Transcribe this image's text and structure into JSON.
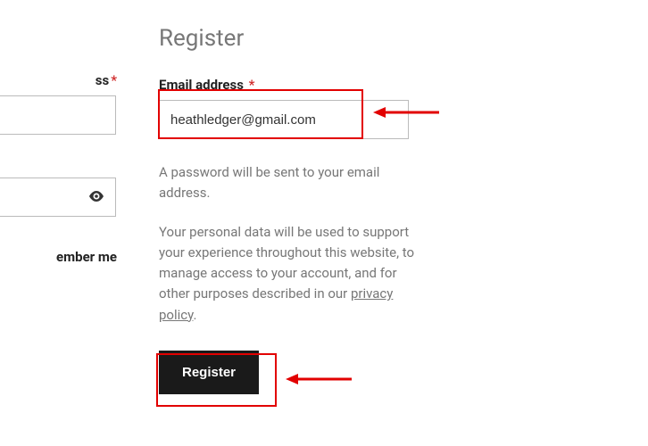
{
  "left": {
    "field1_label_fragment": "ss",
    "remember_label": "ember me"
  },
  "register": {
    "title": "Register",
    "email_label": "Email address",
    "email_value": "heathledger@gmail.com",
    "password_notice": "A password will be sent to your email address.",
    "privacy_text_prefix": "Your personal data will be used to support your experience throughout this website, to manage access to your account, and for other purposes described in our ",
    "privacy_link_text": "privacy policy",
    "button_label": "Register"
  },
  "colors": {
    "accent_red": "#e20000",
    "required_red": "#d02c2c",
    "muted": "#777",
    "dark": "#1a1a1a"
  }
}
